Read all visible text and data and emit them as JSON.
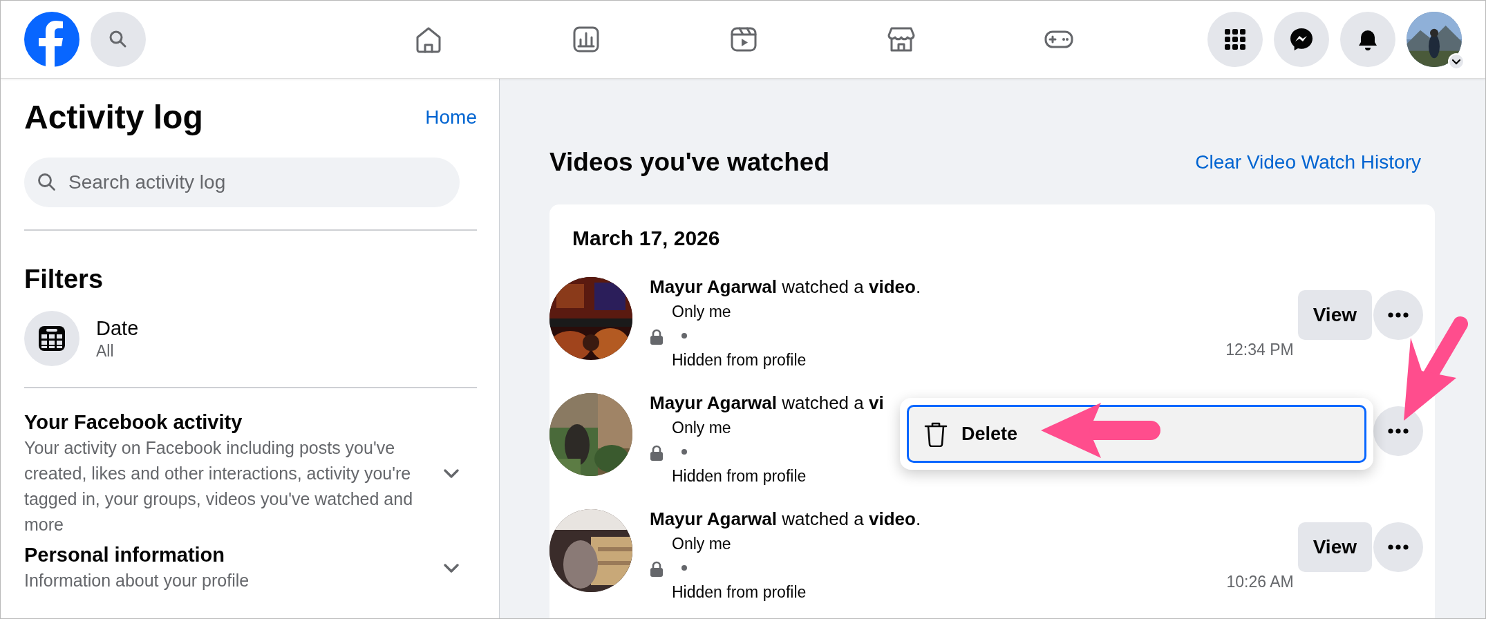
{
  "sidebar": {
    "title": "Activity log",
    "home_link": "Home",
    "search": {
      "placeholder": "Search activity log"
    },
    "filters_title": "Filters",
    "date_filter": {
      "label": "Date",
      "value": "All"
    },
    "sections": [
      {
        "title": "Your Facebook activity",
        "description": "Your activity on Facebook including posts you've created, likes and other interactions, activity you're tagged in, your groups, videos you've watched and more",
        "expanded": false
      },
      {
        "title": "Personal information",
        "description": "Information about your profile",
        "expanded": false
      }
    ]
  },
  "main": {
    "title": "Videos you've watched",
    "clear_link": "Clear Video Watch History",
    "date_header": "March 17, 2026",
    "entries": [
      {
        "text": "**Mayur Agarwal** watched a **video**.",
        "audience": "Only me",
        "visibility": "Hidden from profile",
        "time": "12:34 PM",
        "view_button": "View"
      },
      {
        "text": "**Mayur Agarwal** watched a **vi**",
        "audience": "Only me",
        "visibility": "Hidden from profile",
        "menu": {
          "items": [
            {
              "label": "Delete",
              "selected": true
            }
          ]
        }
      },
      {
        "text": "**Mayur Agarwal** watched a **video**.",
        "audience": "Only me",
        "visibility": "Hidden from profile",
        "time": "10:26 AM",
        "view_button": "View"
      }
    ]
  }
}
